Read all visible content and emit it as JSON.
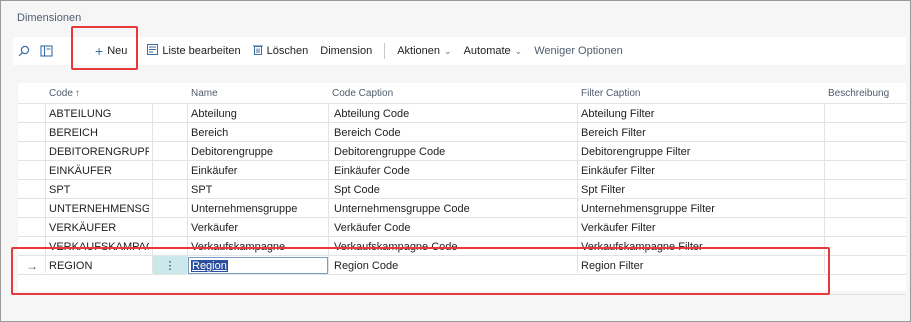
{
  "page": {
    "title": "Dimensionen"
  },
  "toolbar": {
    "search_icon": "search-icon",
    "filter_pane_icon": "filter-pane-icon",
    "new_label": "Neu",
    "edit_list_label": "Liste bearbeiten",
    "delete_label": "Löschen",
    "dimension_label": "Dimension",
    "actions_label": "Aktionen",
    "automate_label": "Automate",
    "fewer_options_label": "Weniger Optionen"
  },
  "grid": {
    "columns": [
      "Code",
      "Name",
      "Code Caption",
      "Filter Caption",
      "Beschreibung"
    ],
    "sort_indicator": "↑",
    "rows": [
      {
        "code": "ABTEILUNG",
        "name": "Abteilung",
        "code_caption": "Abteilung Code",
        "filter_caption": "Abteilung Filter"
      },
      {
        "code": "BEREICH",
        "name": "Bereich",
        "code_caption": "Bereich Code",
        "filter_caption": "Bereich Filter"
      },
      {
        "code": "DEBITORENGRUPPE",
        "name": "Debitorengruppe",
        "code_caption": "Debitorengruppe Code",
        "filter_caption": "Debitorengruppe Filter"
      },
      {
        "code": "EINKÄUFER",
        "name": "Einkäufer",
        "code_caption": "Einkäufer Code",
        "filter_caption": "Einkäufer Filter"
      },
      {
        "code": "SPT",
        "name": "SPT",
        "code_caption": "Spt Code",
        "filter_caption": "Spt Filter"
      },
      {
        "code": "UNTERNEHMENSGRU...",
        "name": "Unternehmensgruppe",
        "code_caption": "Unternehmensgruppe Code",
        "filter_caption": "Unternehmensgruppe Filter"
      },
      {
        "code": "VERKÄUFER",
        "name": "Verkäufer",
        "code_caption": "Verkäufer Code",
        "filter_caption": "Verkäufer Filter"
      },
      {
        "code": "VERKAUFSKAMPAGNE",
        "name": "Verkaufskampagne",
        "code_caption": "Verkaufskampagne Code",
        "filter_caption": "Verkaufskampagne Filter"
      }
    ],
    "selected_row": {
      "code": "REGION",
      "name": "Region",
      "code_caption": "Region Code",
      "filter_caption": "Region Filter"
    }
  },
  "colors": {
    "highlight": "#e5393a",
    "accent": "#3a6ea5",
    "selection": "#cbe9ea"
  }
}
